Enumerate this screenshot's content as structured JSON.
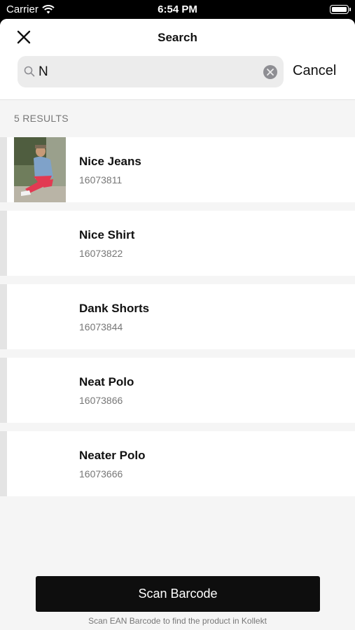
{
  "status_bar": {
    "carrier": "Carrier",
    "time": "6:54 PM"
  },
  "header": {
    "title": "Search",
    "cancel_label": "Cancel"
  },
  "search": {
    "value": "N",
    "placeholder": ""
  },
  "results": {
    "count_label": "5 RESULTS",
    "items": [
      {
        "name": "Nice Jeans",
        "sku": "16073811",
        "has_image": true
      },
      {
        "name": "Nice Shirt",
        "sku": "16073822",
        "has_image": false
      },
      {
        "name": "Dank Shorts",
        "sku": "16073844",
        "has_image": false
      },
      {
        "name": "Neat Polo",
        "sku": "16073866",
        "has_image": false
      },
      {
        "name": "Neater Polo",
        "sku": "16073666",
        "has_image": false
      }
    ]
  },
  "footer": {
    "scan_label": "Scan Barcode",
    "hint": "Scan EAN Barcode to find the product in Kollekt"
  },
  "icons": {
    "close": "close-icon",
    "search": "search-icon",
    "clear": "clear-icon",
    "wifi": "wifi-icon",
    "battery": "battery-icon"
  }
}
